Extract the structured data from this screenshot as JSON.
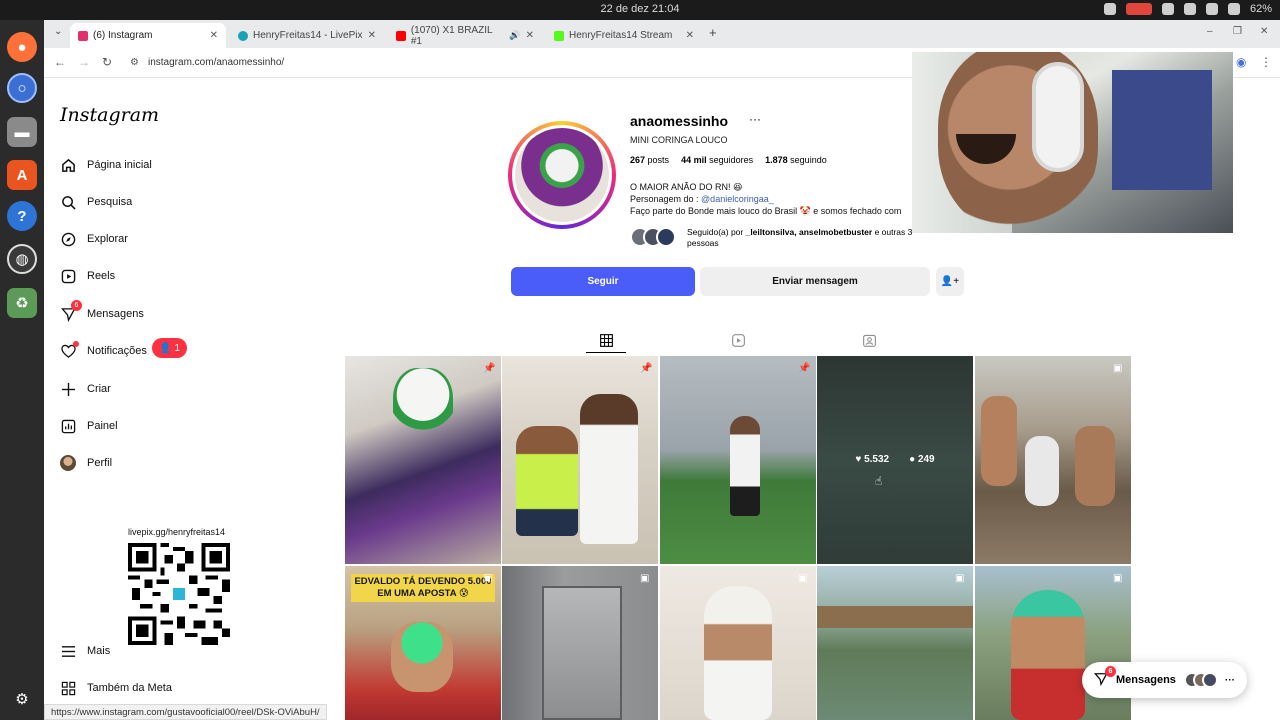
{
  "os": {
    "clock": "22 de dez  21:04",
    "battery": "62%"
  },
  "browser": {
    "tabs": [
      {
        "title": "(6) Instagram",
        "favicon_color": "#e1306c",
        "active": true
      },
      {
        "title": "HenryFreitas14 - LivePix",
        "favicon_color": "#17a2b8",
        "active": false
      },
      {
        "title": "(1070) X1 BRAZIL #1",
        "favicon_color": "#ff0000",
        "active": false
      },
      {
        "title": "HenryFreitas14 Stream",
        "favicon_color": "#53fc18",
        "active": false
      }
    ],
    "url": "instagram.com/anaomessinho/"
  },
  "sidebar": {
    "logo": "Instagram",
    "items": [
      {
        "label": "Página inicial",
        "icon": "home-icon"
      },
      {
        "label": "Pesquisa",
        "icon": "search-icon"
      },
      {
        "label": "Explorar",
        "icon": "compass-icon"
      },
      {
        "label": "Reels",
        "icon": "reels-icon"
      },
      {
        "label": "Mensagens",
        "icon": "messenger-icon",
        "badge": "6"
      },
      {
        "label": "Notificações",
        "icon": "heart-icon"
      },
      {
        "label": "Criar",
        "icon": "plus-icon"
      },
      {
        "label": "Painel",
        "icon": "dashboard-icon"
      },
      {
        "label": "Perfil",
        "icon": "avatar"
      }
    ],
    "notification_bubble": "1",
    "bottom": [
      {
        "label": "Mais",
        "icon": "menu-icon"
      },
      {
        "label": "Também da Meta",
        "icon": "meta-grid-icon"
      }
    ]
  },
  "overlay": {
    "qr_caption": "livepix.gg/henryfreitas14"
  },
  "profile": {
    "username": "anaomessinho",
    "more": "···",
    "subtitle": "MINI CORINGA LOUCO",
    "posts_count": "267",
    "posts_label": "posts",
    "followers_count": "44 mil",
    "followers_label": "seguidores",
    "following_count": "1.878",
    "following_label": "seguindo",
    "bio_line1": "O MAIOR ANÃO DO RN! 😆",
    "bio_line2_prefix": "Personagem do : ",
    "bio_line2_link": "@danielcoringaa_",
    "bio_line3": "Faço parte do Bonde mais louco do Brasil 🤡 e somos fechado com",
    "followed_by_prefix": "Seguido(a) por ",
    "followed_by_names": "_leiltonsilva, anselmobetbuster",
    "followed_by_suffix": " e outras 3",
    "followed_by_line2": "pessoas",
    "follow_button": "Seguir",
    "message_button": "Enviar mensagem"
  },
  "posts": {
    "hover_likes": "5.532",
    "hover_comments": "249",
    "banner_text": "EDVALDO TÁ DEVENDO 5.000 EM UMA APOSTA 😰"
  },
  "floating": {
    "messages_label": "Mensagens",
    "messages_badge": "6"
  },
  "status_bar": {
    "url": "https://www.instagram.com/gustavooficial00/reel/DSk-OViAbuH/"
  }
}
